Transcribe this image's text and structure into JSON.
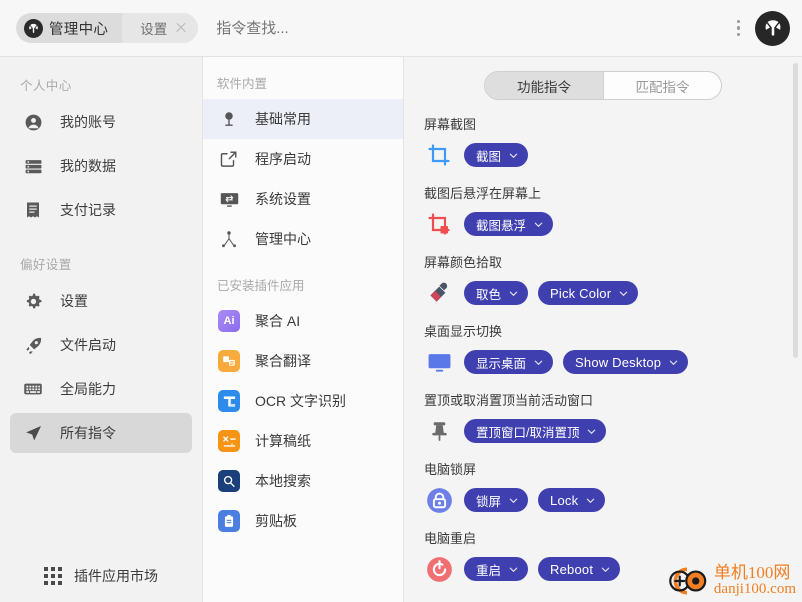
{
  "topbar": {
    "app_tab_label": "管理中心",
    "sub_tab_label": "设置",
    "search_placeholder": "指令查找...",
    "brand_icon": "brand-logo-icon",
    "more_icon": "more-vertical-icon",
    "close_icon": "close-icon"
  },
  "sidebar": {
    "sections": [
      {
        "title": "个人中心",
        "items": [
          {
            "label": "我的账号",
            "icon": "user-circle-icon",
            "active": false
          },
          {
            "label": "我的数据",
            "icon": "database-list-icon",
            "active": false
          },
          {
            "label": "支付记录",
            "icon": "receipt-icon",
            "active": false
          }
        ]
      },
      {
        "title": "偏好设置",
        "items": [
          {
            "label": "设置",
            "icon": "gear-icon",
            "active": false
          },
          {
            "label": "文件启动",
            "icon": "rocket-icon",
            "active": false
          },
          {
            "label": "全局能力",
            "icon": "keyboard-icon",
            "active": false
          },
          {
            "label": "所有指令",
            "icon": "navigation-arrow-icon",
            "active": true
          }
        ]
      }
    ],
    "footer": {
      "label": "插件应用市场",
      "icon": "grid-apps-icon"
    }
  },
  "midcol": {
    "sections": [
      {
        "title": "软件内置",
        "items": [
          {
            "label": "基础常用",
            "icon": "pin-marker-icon",
            "active": true
          },
          {
            "label": "程序启动",
            "icon": "external-link-icon",
            "active": false
          },
          {
            "label": "系统设置",
            "icon": "monitor-swap-icon",
            "active": false
          },
          {
            "label": "管理中心",
            "icon": "org-tree-icon",
            "active": false
          }
        ]
      },
      {
        "title": "已安装插件应用",
        "items": [
          {
            "label": "聚合 AI",
            "icon": "ai-app-icon",
            "badge": "Ai",
            "color": "#9b7ff0",
            "active": false
          },
          {
            "label": "聚合翻译",
            "icon": "translate-app-icon",
            "badge": "",
            "color": "#f5a githubj",
            "active": false
          },
          {
            "label": "OCR 文字识别",
            "icon": "ocr-app-icon",
            "badge": "",
            "color": "#2d8ceb",
            "active": false
          },
          {
            "label": "计算稿纸",
            "icon": "calculator-app-icon",
            "badge": "",
            "color": "#f59415",
            "active": false
          },
          {
            "label": "本地搜索",
            "icon": "local-search-app-icon",
            "badge": "",
            "color": "#1b3f7a",
            "active": false
          },
          {
            "label": "剪贴板",
            "icon": "clipboard-app-icon",
            "badge": "",
            "color": "#4a7fe0",
            "active": false
          }
        ]
      }
    ]
  },
  "rightpanel": {
    "tabs": [
      {
        "label": "功能指令",
        "active": true
      },
      {
        "label": "匹配指令",
        "active": false
      }
    ],
    "groups": [
      {
        "title": "屏幕截图",
        "icon": "crop-blue-icon",
        "pills": [
          {
            "label": "截图",
            "lang": "cn"
          }
        ]
      },
      {
        "title": "截图后悬浮在屏幕上",
        "icon": "crop-red-icon",
        "pills": [
          {
            "label": "截图悬浮",
            "lang": "cn"
          }
        ]
      },
      {
        "title": "屏幕颜色拾取",
        "icon": "eyedropper-icon",
        "pills": [
          {
            "label": "取色",
            "lang": "cn"
          },
          {
            "label": "Pick Color",
            "lang": "en"
          }
        ]
      },
      {
        "title": "桌面显示切换",
        "icon": "monitor-icon",
        "pills": [
          {
            "label": "显示桌面",
            "lang": "cn"
          },
          {
            "label": "Show Desktop",
            "lang": "en"
          }
        ]
      },
      {
        "title": "置顶或取消置顶当前活动窗口",
        "icon": "pushpin-icon",
        "pills": [
          {
            "label": "置顶窗口/取消置顶",
            "lang": "cn"
          }
        ]
      },
      {
        "title": "电脑锁屏",
        "icon": "lock-icon",
        "pills": [
          {
            "label": "锁屏",
            "lang": "cn"
          },
          {
            "label": "Lock",
            "lang": "en"
          }
        ]
      },
      {
        "title": "电脑重启",
        "icon": "reboot-icon",
        "pills": [
          {
            "label": "重启",
            "lang": "cn"
          },
          {
            "label": "Reboot",
            "lang": "en"
          }
        ]
      }
    ]
  },
  "watermark": {
    "cn": "单机100网",
    "en": "danji100.com",
    "icon": "danji-logo-icon",
    "color": "#f07f23"
  },
  "colors": {
    "pill": "#3f3fb0",
    "active_mid": "#eceef8",
    "active_side": "#d8d8d8"
  }
}
